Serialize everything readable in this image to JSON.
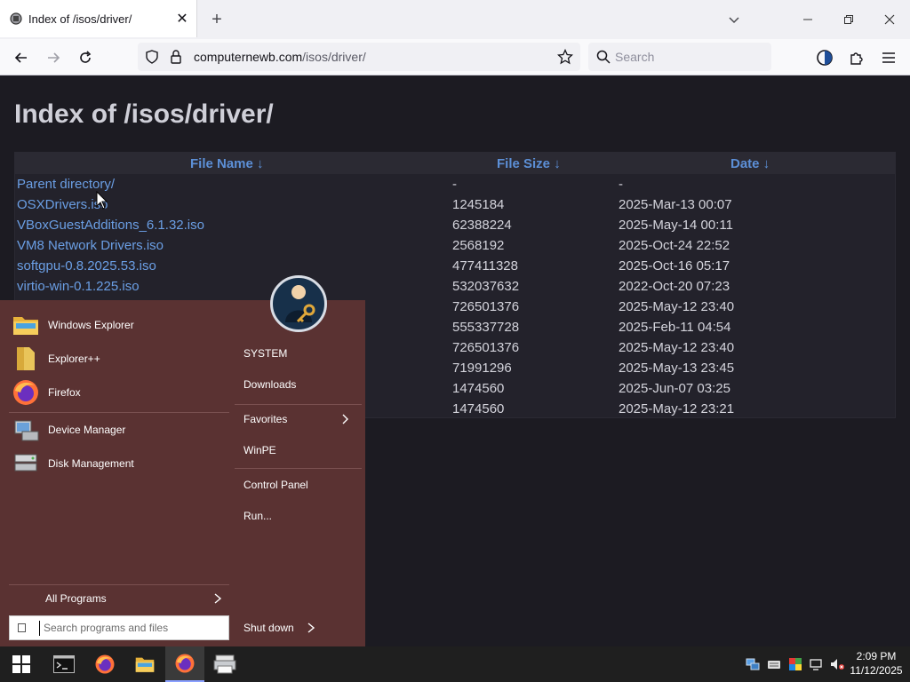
{
  "browser": {
    "tab": {
      "title": "Index of /isos/driver/"
    },
    "url": {
      "domain": "computernewb.com",
      "path": "/isos/driver/"
    },
    "search": {
      "placeholder": "Search"
    }
  },
  "page": {
    "title": "Index of /isos/driver/",
    "columns": {
      "name": "File Name  ↓",
      "size": "File Size  ↓",
      "date": "Date  ↓"
    },
    "rows": [
      {
        "name": "Parent directory/",
        "size": "-",
        "date": "-"
      },
      {
        "name": "OSXDrivers.iso",
        "size": "1245184",
        "date": "2025-Mar-13 00:07"
      },
      {
        "name": "VBoxGuestAdditions_6.1.32.iso",
        "size": "62388224",
        "date": "2025-May-14 00:11"
      },
      {
        "name": "VM8 Network Drivers.iso",
        "size": "2568192",
        "date": "2025-Oct-24 22:52"
      },
      {
        "name": "softgpu-0.8.2025.53.iso",
        "size": "477411328",
        "date": "2025-Oct-16 05:17"
      },
      {
        "name": "virtio-win-0.1.225.iso",
        "size": "532037632",
        "date": "2022-Oct-20 07:23"
      },
      {
        "name": "",
        "size": "726501376",
        "date": "2025-May-12 23:40"
      },
      {
        "name": "",
        "size": "555337728",
        "date": "2025-Feb-11 04:54"
      },
      {
        "name": "",
        "size": "726501376",
        "date": "2025-May-12 23:40"
      },
      {
        "name": "",
        "size": "71991296",
        "date": "2025-May-13 23:45"
      },
      {
        "name": "",
        "size": "1474560",
        "date": "2025-Jun-07 03:25"
      },
      {
        "name": "",
        "size": "1474560",
        "date": "2025-May-12 23:21"
      }
    ]
  },
  "startmenu": {
    "pinned": [
      {
        "label": "Windows Explorer",
        "icon": "folder-icon"
      },
      {
        "label": "Explorer++",
        "icon": "explorer-plus-icon"
      },
      {
        "label": "Firefox",
        "icon": "firefox-icon"
      }
    ],
    "recent": [
      {
        "label": "Device Manager",
        "icon": "device-manager-icon"
      },
      {
        "label": "Disk Management",
        "icon": "disk-management-icon"
      }
    ],
    "all_programs": "All Programs",
    "search_placeholder": "Search programs and files",
    "right": {
      "system": "SYSTEM",
      "downloads": "Downloads",
      "favorites": "Favorites",
      "winpe": "WinPE",
      "control_panel": "Control Panel",
      "run": "Run..."
    },
    "shutdown": "Shut down"
  },
  "taskbar": {
    "clock": {
      "time": "2:09 PM",
      "date": "11/12/2025"
    }
  },
  "colors": {
    "link": "#6b9fe5",
    "header": "#5c8fd6",
    "startmenu_bg": "#5a3232",
    "page_bg": "#1c1b22"
  }
}
